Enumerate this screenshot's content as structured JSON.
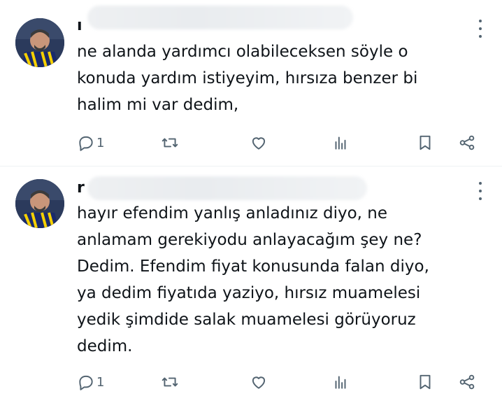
{
  "replies": [
    {
      "handle_initial": "ı",
      "avatar_alt": "profile-photo",
      "text": "ne alanda yardımcı olabileceksen söyle o\nkonuda yardım istiyeyim, hırsıza benzer bi\nhalim mi var dedim,",
      "reply_count": "1",
      "icons": [
        "reply-icon",
        "retweet-icon",
        "like-icon",
        "views-icon",
        "bookmark-icon",
        "share-icon"
      ]
    },
    {
      "handle_initial": "r",
      "avatar_alt": "profile-photo",
      "text": "hayır efendim yanlış anladınız diyo, ne\nanlamam gerekiyodu anlayacağım şey ne?\nDedim. Efendim fiyat konusunda falan diyo,\nya dedim fiyatıda yaziyo, hırsız muamelesi\nyedik şimdide salak muamelesi görüyoruz\ndedim.",
      "reply_count": "1",
      "icons": [
        "reply-icon",
        "retweet-icon",
        "like-icon",
        "views-icon",
        "bookmark-icon",
        "share-icon"
      ]
    }
  ]
}
